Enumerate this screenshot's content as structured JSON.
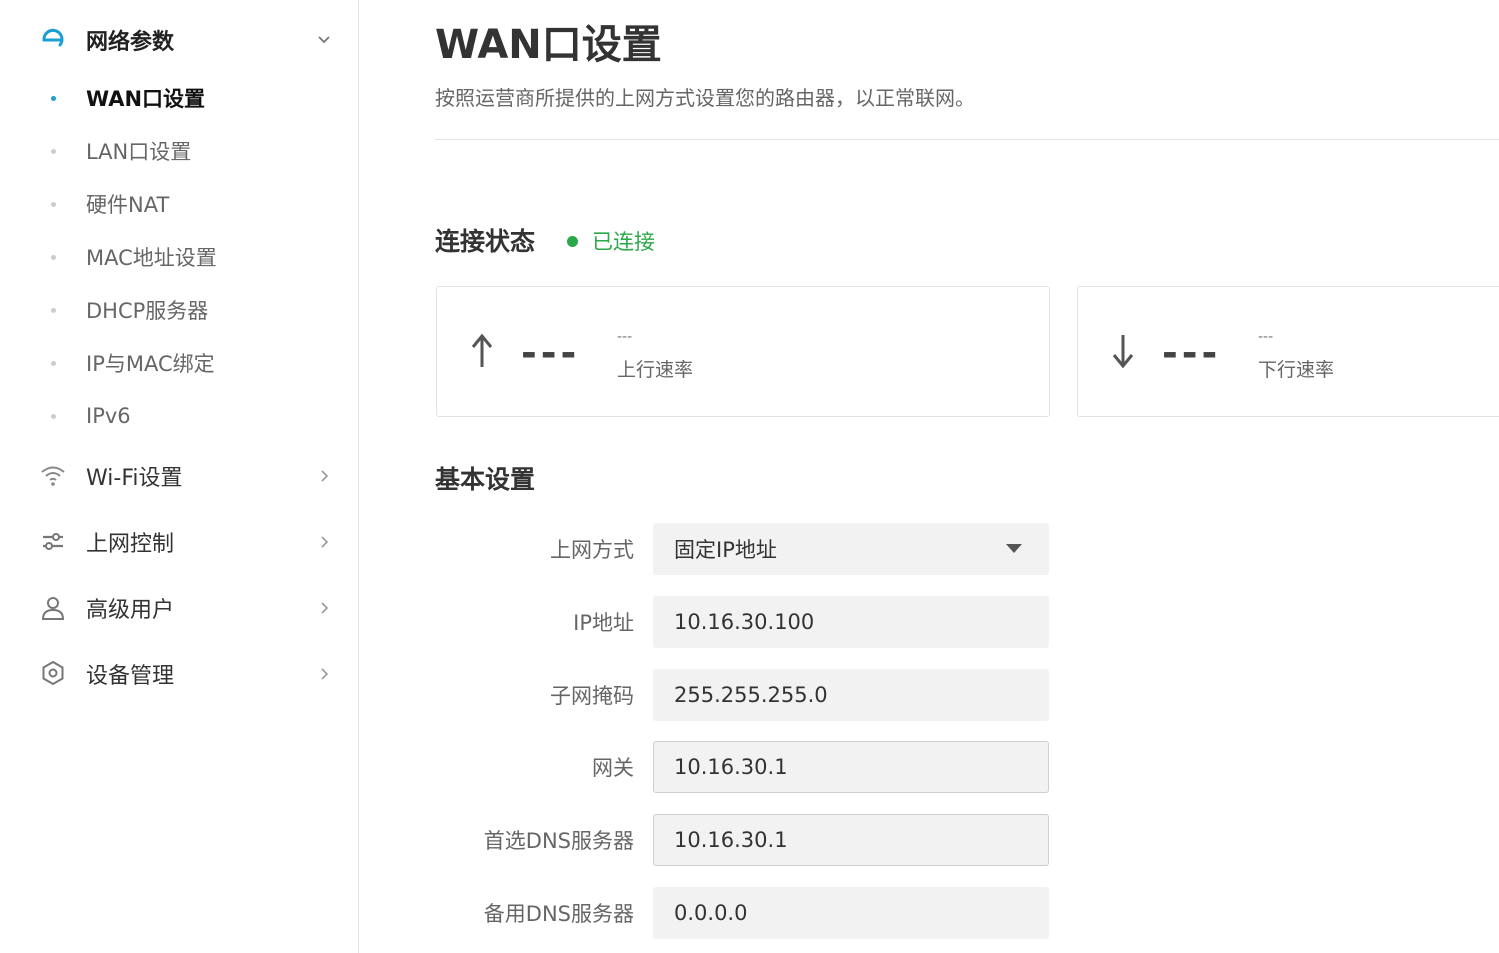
{
  "sidebar": {
    "network": {
      "label": "网络参数",
      "items": [
        {
          "label": "WAN口设置"
        },
        {
          "label": "LAN口设置"
        },
        {
          "label": "硬件NAT"
        },
        {
          "label": "MAC地址设置"
        },
        {
          "label": "DHCP服务器"
        },
        {
          "label": "IP与MAC绑定"
        },
        {
          "label": "IPv6"
        }
      ]
    },
    "wifi": {
      "label": "Wi-Fi设置"
    },
    "access": {
      "label": "上网控制"
    },
    "advanced": {
      "label": "高级用户"
    },
    "device": {
      "label": "设备管理"
    }
  },
  "page": {
    "title": "WAN口设置",
    "description": "按照运营商所提供的上网方式设置您的路由器，以正常联网。"
  },
  "status": {
    "heading": "连接状态",
    "text": "已连接",
    "color": "#2aa84a"
  },
  "speed": {
    "up": {
      "value": "---",
      "small": "---",
      "label": "上行速率"
    },
    "down": {
      "value": "---",
      "small": "---",
      "label": "下行速率"
    }
  },
  "basic": {
    "heading": "基本设置",
    "mode": {
      "label": "上网方式",
      "value": "固定IP地址"
    },
    "ip": {
      "label": "IP地址",
      "value": "10.16.30.100"
    },
    "mask": {
      "label": "子网掩码",
      "value": "255.255.255.0"
    },
    "gateway": {
      "label": "网关",
      "value": "10.16.30.1"
    },
    "dns1": {
      "label": "首选DNS服务器",
      "value": "10.16.30.1"
    },
    "dns2": {
      "label": "备用DNS服务器",
      "value": "0.0.0.0"
    }
  },
  "colors": {
    "accent": "#1a9ed4",
    "success": "#2aa84a"
  },
  "icons": [
    "network-icon",
    "wifi-icon",
    "sliders-icon",
    "user-icon",
    "gear-icon",
    "arrow-up-icon",
    "arrow-down-icon",
    "chevron-down-icon",
    "chevron-right-icon",
    "caret-down-icon"
  ]
}
